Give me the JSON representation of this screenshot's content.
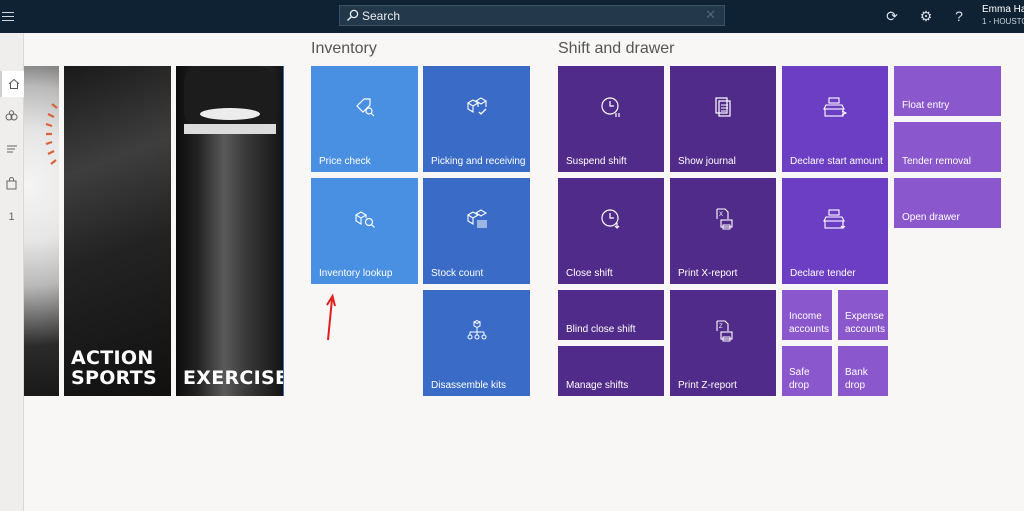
{
  "topbar": {
    "search_label": "Search",
    "user_name": "Emma Ha",
    "user_store": "1 - HOUSTO"
  },
  "sidebar": {
    "page_number": "1"
  },
  "hero": {
    "action_sports": "ACTION\nSPORTS",
    "exercise": "EXERCISE"
  },
  "inventory": {
    "title": "Inventory",
    "tiles": [
      {
        "label": "Price check",
        "icon": "price-tag-search-icon"
      },
      {
        "label": "Picking and receiving",
        "icon": "boxes-check-icon"
      },
      {
        "label": "Inventory lookup",
        "icon": "boxes-search-icon"
      },
      {
        "label": "Stock count",
        "icon": "boxes-barcode-icon"
      },
      {
        "label": "Disassemble kits",
        "icon": "hierarchy-icon"
      }
    ]
  },
  "shift": {
    "title": "Shift and drawer",
    "tiles": [
      {
        "label": "Suspend shift",
        "icon": "clock-pause-icon"
      },
      {
        "label": "Show journal",
        "icon": "journal-icon"
      },
      {
        "label": "Declare start amount",
        "icon": "register-icon"
      },
      {
        "label": "Float entry"
      },
      {
        "label": "Tender removal"
      },
      {
        "label": "Close shift",
        "icon": "clock-down-icon"
      },
      {
        "label": "Print X-report",
        "icon": "print-x-icon"
      },
      {
        "label": "Declare tender",
        "icon": "register-down-icon"
      },
      {
        "label": "Open drawer"
      },
      {
        "label": "Blind close shift"
      },
      {
        "label": "Print Z-report",
        "icon": "print-z-icon"
      },
      {
        "label": "Income accounts"
      },
      {
        "label": "Expense accounts"
      },
      {
        "label": "Manage shifts"
      },
      {
        "label": "Safe drop"
      },
      {
        "label": "Bank drop"
      }
    ]
  },
  "colors": {
    "topbar": "#0f2233",
    "inventory_light": "#4a90e2",
    "inventory_dark": "#3a6cc7",
    "shift_dark": "#512b89",
    "shift_light": "#8a58cc",
    "annotation_arrow": "#e02020"
  }
}
